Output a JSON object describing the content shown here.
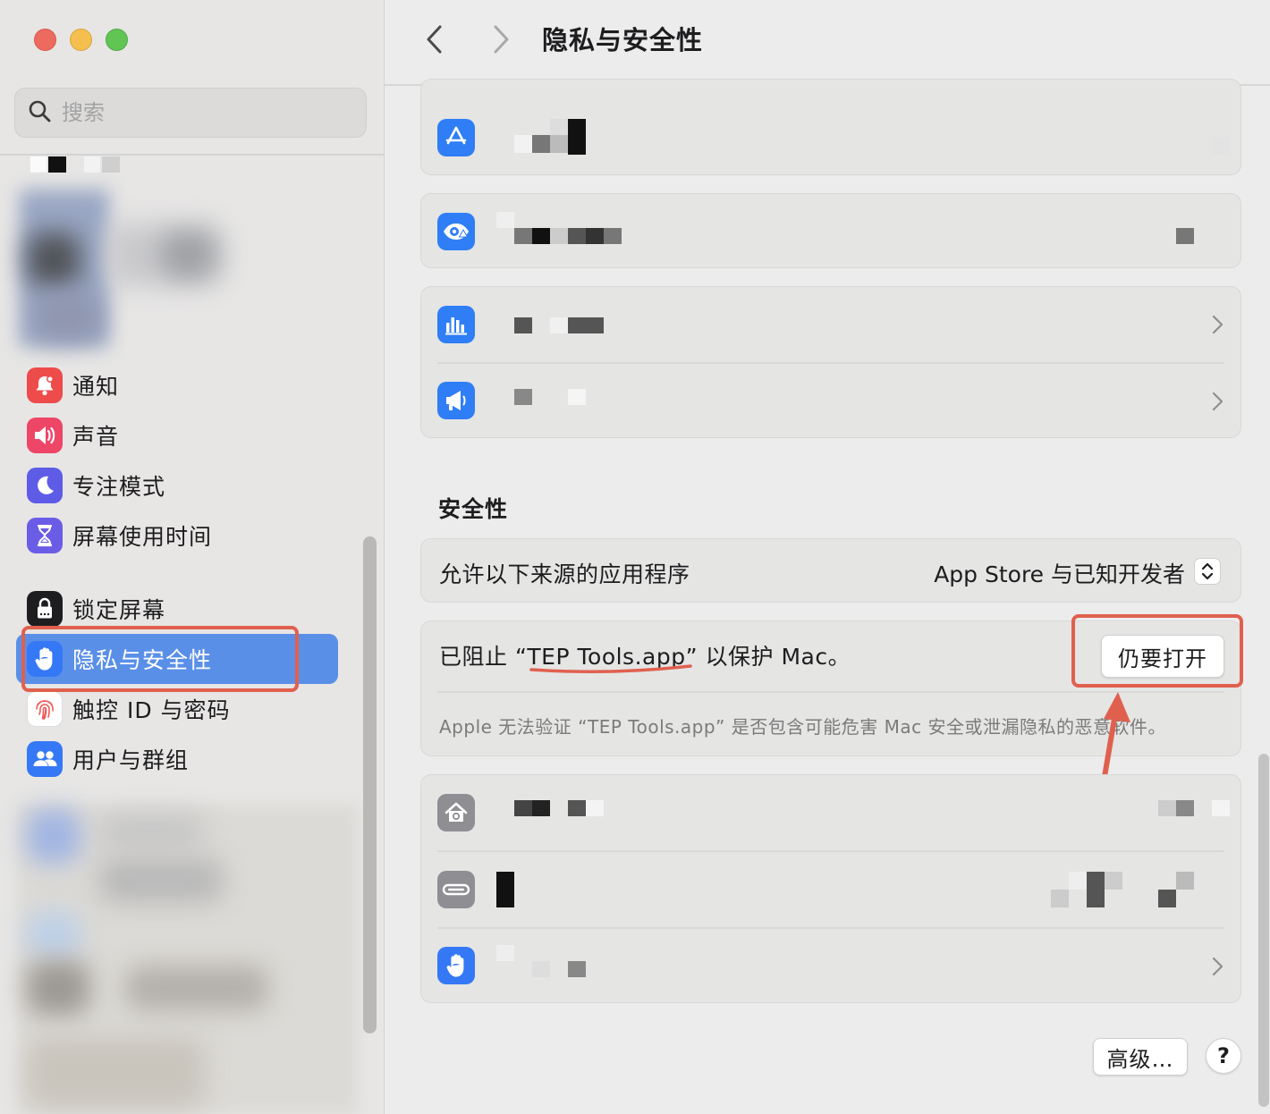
{
  "window": {
    "title": "隐私与安全性"
  },
  "search": {
    "placeholder": "搜索"
  },
  "sidebar": {
    "items": [
      {
        "label": "通知",
        "icon": "bell-icon",
        "color": "#ee4b4b"
      },
      {
        "label": "声音",
        "icon": "speaker-icon",
        "color": "#ee4667"
      },
      {
        "label": "专注模式",
        "icon": "moon-icon",
        "color": "#5e5ce6"
      },
      {
        "label": "屏幕使用时间",
        "icon": "hourglass-icon",
        "color": "#6b5ce6"
      },
      {
        "label": "锁定屏幕",
        "icon": "lock-screen-icon",
        "color": "#1d1d1f"
      },
      {
        "label": "隐私与安全性",
        "icon": "hand-icon",
        "color": "#3478f6",
        "selected": true
      },
      {
        "label": "触控 ID 与密码",
        "icon": "fingerprint-icon",
        "color": "#ffffff"
      },
      {
        "label": "用户与群组",
        "icon": "users-icon",
        "color": "#3478f6"
      }
    ]
  },
  "security": {
    "section_title": "安全性",
    "allow_label": "允许以下来源的应用程序",
    "allow_value": "App Store 与已知开发者",
    "blocked_prefix": "已阻止 “",
    "blocked_app": "TEP Tools.app",
    "blocked_suffix": "” 以保护 Mac。",
    "open_anyway": "仍要打开",
    "warning": "Apple 无法验证 “TEP Tools.app” 是否包含可能危害 Mac 安全或泄漏隐私的恶意软件。"
  },
  "footer": {
    "advanced": "高级…",
    "help": "?"
  },
  "colors": {
    "accent": "#3478f6",
    "selection": "#5a8fe8",
    "annotation": "#e0604e"
  }
}
